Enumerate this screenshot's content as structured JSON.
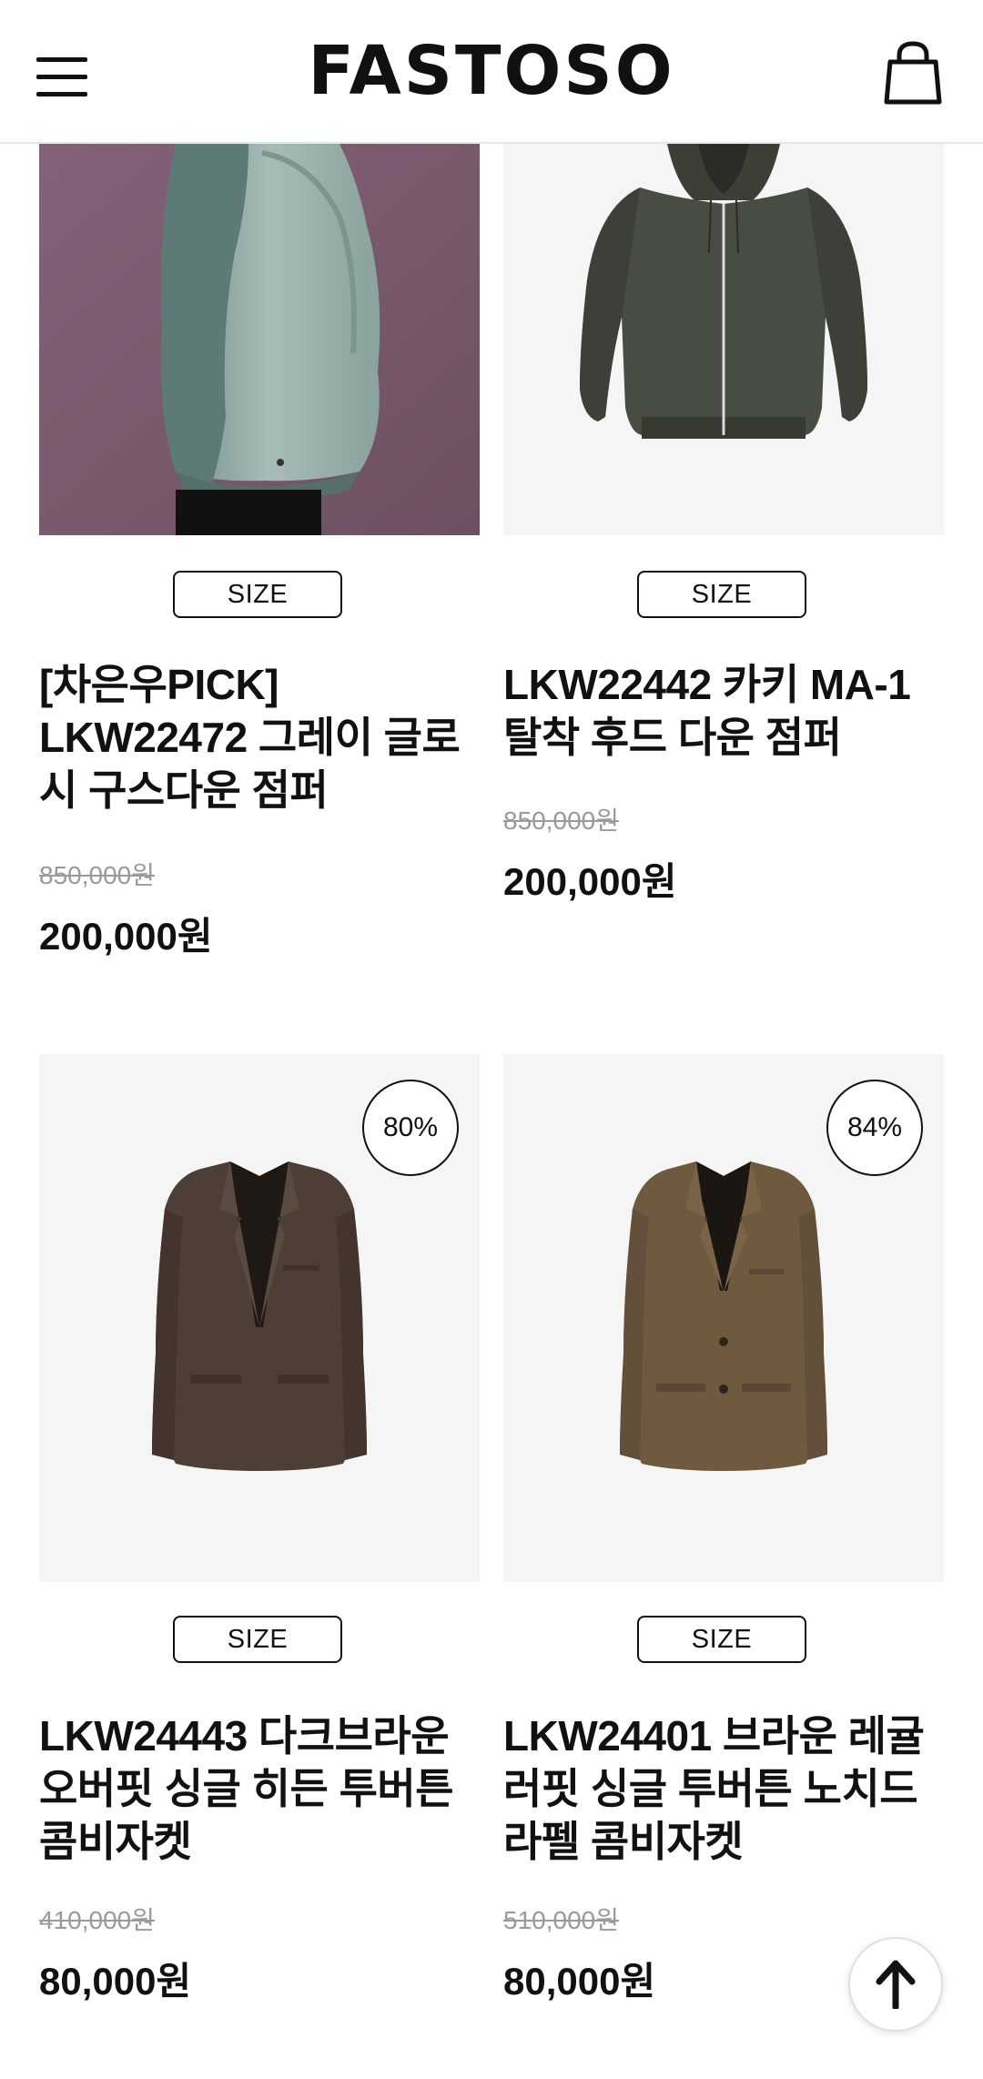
{
  "header": {
    "logo_text": "FASTOSO",
    "menu_icon": "hamburger-menu-icon",
    "cart_icon": "shopping-bag-icon"
  },
  "products": [
    {
      "size_label": "SIZE",
      "title": "[차은우PICK] LKW22472 그레이 글로시 구스다운 점퍼",
      "original_price": "850,000원",
      "sale_price": "200,000원"
    },
    {
      "size_label": "SIZE",
      "title": "LKW22442 카키 MA-1 탈착 후드 다운 점퍼",
      "original_price": "850,000원",
      "sale_price": "200,000원"
    },
    {
      "discount": "80%",
      "size_label": "SIZE",
      "title": "LKW24443 다크브라운 오버핏 싱글 히든 투버튼 콤비자켓",
      "original_price": "410,000원",
      "sale_price": "80,000원"
    },
    {
      "discount": "84%",
      "size_label": "SIZE",
      "title": "LKW24401 브라운 레귤러핏 싱글 투버튼 노치드 라펠 콤비자켓",
      "original_price": "510,000원",
      "sale_price": "80,000원"
    }
  ],
  "scroll_top_icon": "arrow-up-icon",
  "colors": {
    "text": "#111111",
    "muted": "#9a9a9a",
    "image_bg": "#f5f5f5",
    "product1_bg": "#7b5a6e"
  }
}
